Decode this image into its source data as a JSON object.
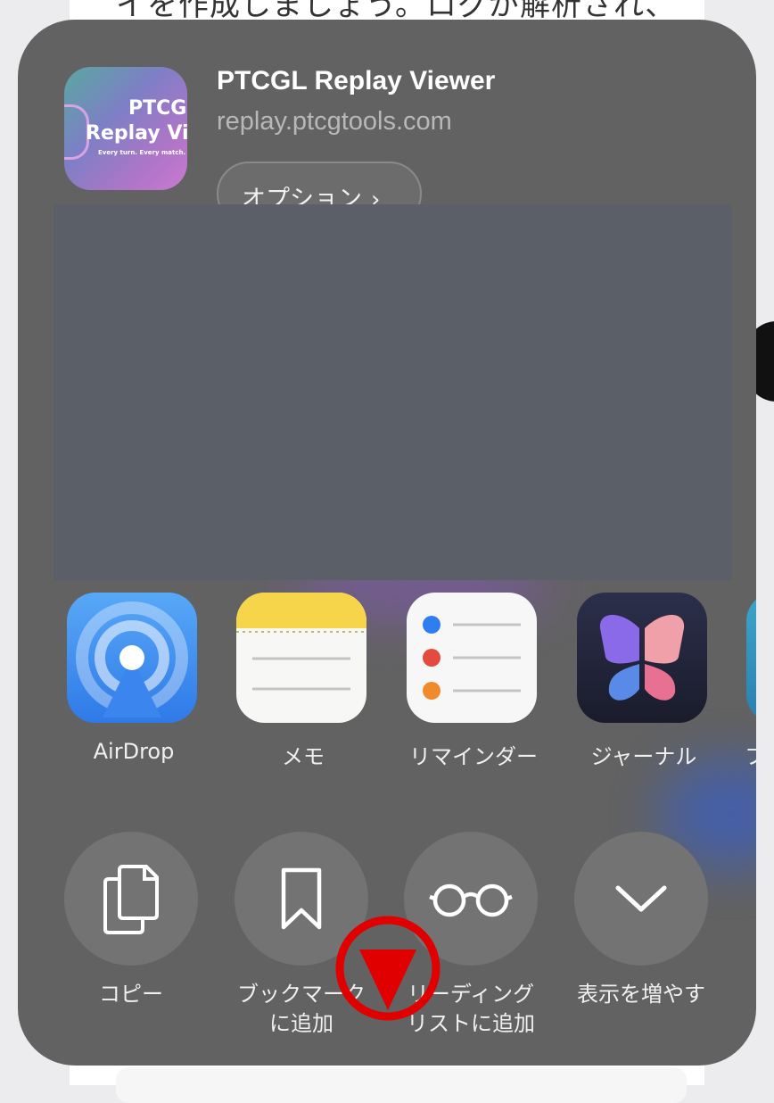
{
  "background_page": {
    "text": "イを作成しましょう。ログが解析され、"
  },
  "share_sheet": {
    "header": {
      "app_icon": {
        "line1": "PTCGL",
        "line2": "Replay Vie",
        "tagline": "Every turn. Every match. Eve"
      },
      "title": "PTCGL Replay Viewer",
      "url": "replay.ptcgtools.com",
      "options_label": "オプション",
      "options_icon": "chevron-right-icon"
    },
    "apps": [
      {
        "label": "AirDrop",
        "icon": "airdrop-icon"
      },
      {
        "label": "メモ",
        "icon": "notes-icon"
      },
      {
        "label": "リマインダー",
        "icon": "reminders-icon"
      },
      {
        "label": "ジャーナル",
        "icon": "journal-icon"
      },
      {
        "label": "フ",
        "icon": "app-icon"
      }
    ],
    "actions": [
      {
        "label_line1": "コピー",
        "label_line2": "",
        "icon": "copy-icon"
      },
      {
        "label_line1": "ブックマーク",
        "label_line2": "に追加",
        "icon": "bookmark-icon"
      },
      {
        "label_line1": "リーディング",
        "label_line2": "リストに追加",
        "icon": "glasses-icon"
      },
      {
        "label_line1": "表示を増やす",
        "label_line2": "",
        "icon": "chevron-down-icon"
      }
    ]
  },
  "colors": {
    "sheet_bg": "#626262",
    "action_circle": "#737373",
    "annotation_red": "#e00000"
  }
}
